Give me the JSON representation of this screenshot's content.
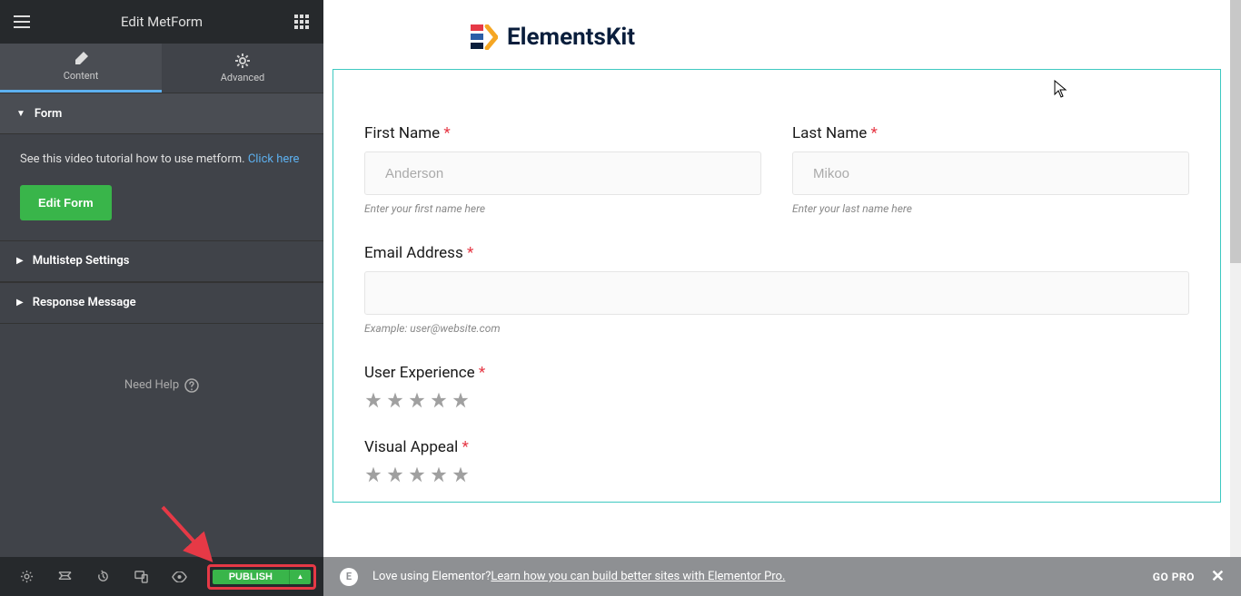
{
  "header": {
    "title": "Edit MetForm"
  },
  "tabs": {
    "content": "Content",
    "advanced": "Advanced"
  },
  "sections": {
    "form": {
      "title": "Form",
      "tutorial_text": "See this video tutorial how to use metform. ",
      "tutorial_link": "Click here",
      "edit_button": "Edit Form"
    },
    "multistep": {
      "title": "Multistep Settings"
    },
    "response": {
      "title": "Response Message"
    }
  },
  "need_help": "Need Help",
  "bottombar": {
    "publish": "PUBLISH",
    "promo_text": "Love using Elementor? ",
    "promo_link": "Learn how you can build better sites with Elementor Pro.",
    "go_pro": "GO PRO"
  },
  "logo": {
    "text": "ElementsKit"
  },
  "form": {
    "first_name": {
      "label": "First Name ",
      "placeholder": "Anderson",
      "help": "Enter your first name here"
    },
    "last_name": {
      "label": "Last Name ",
      "placeholder": "Mikoo",
      "help": "Enter your last name here"
    },
    "email": {
      "label": "Email Address ",
      "help": "Example: user@website.com"
    },
    "user_exp": {
      "label": "User Experience "
    },
    "visual": {
      "label": "Visual Appeal "
    },
    "required": "*"
  }
}
